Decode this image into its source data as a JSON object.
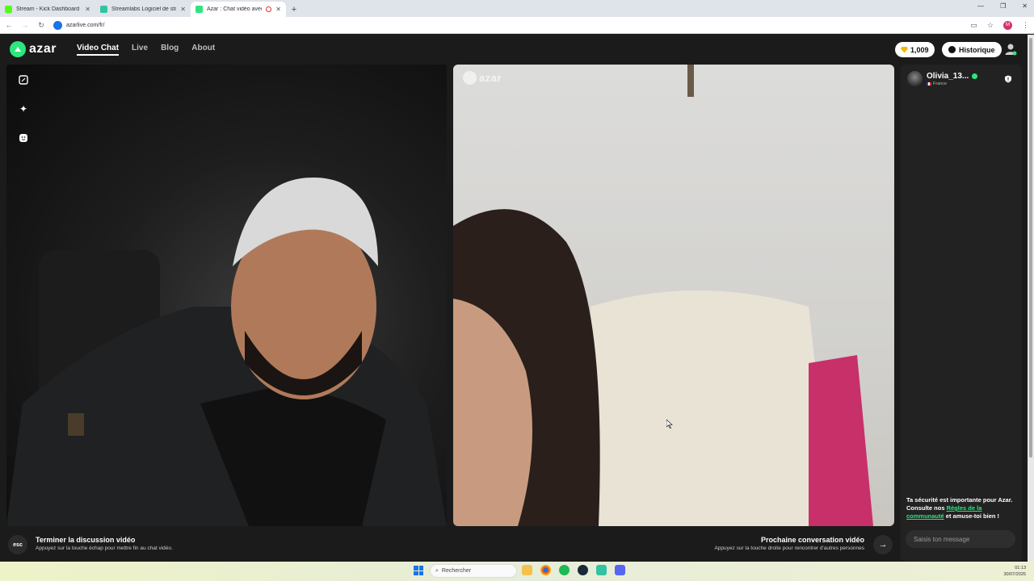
{
  "browser": {
    "tabs": [
      {
        "title": "Stream - Kick Dashboard",
        "favicon_color": "#53fc18",
        "active": false
      },
      {
        "title": "Streamlabs Logiciel de streami...",
        "favicon_color": "#31c3a2",
        "active": false
      },
      {
        "title": "Azar : Chat vidéo avec de n...",
        "favicon_color": "#2ee57e",
        "active": true
      }
    ],
    "new_tab": "+",
    "url": "azarlive.com/fr/",
    "profile_initial": "M"
  },
  "app": {
    "logo": "azar",
    "nav": [
      {
        "label": "Video Chat",
        "active": true
      },
      {
        "label": "Live",
        "active": false
      },
      {
        "label": "Blog",
        "active": false
      },
      {
        "label": "About",
        "active": false
      }
    ],
    "coins": "1,009",
    "history_label": "Historique",
    "accent": "#2ee57e"
  },
  "video": {
    "right_watermark": "azar"
  },
  "chat": {
    "peer_name": "Olivia_13...",
    "peer_country": "France",
    "safety_pre": "Ta sécurité est importante pour Azar. Consulte nos ",
    "safety_link": "Règles de la communauté",
    "safety_post": " et amuse-toi bien !",
    "message_placeholder": "Saisis ton message"
  },
  "bottom": {
    "esc_key": "esc",
    "end_title": "Terminer la discussion vidéo",
    "end_sub": "Appuyez sur la touche échap pour mettre fin au chat vidéo.",
    "next_title": "Prochaine conversation vidéo",
    "next_sub": "Appuyez sur la touche droite pour rencontrer d'autres personnes",
    "next_arrow": "→"
  },
  "taskbar": {
    "search_label": "Rechercher",
    "time": "01:13",
    "date": "30/07/2025"
  }
}
